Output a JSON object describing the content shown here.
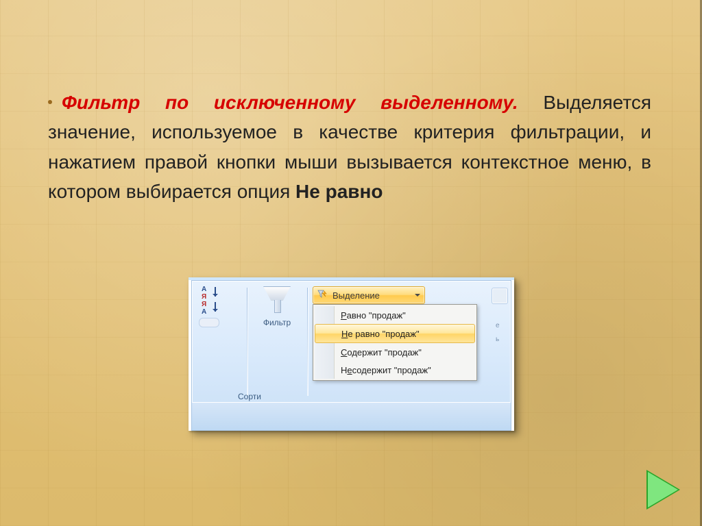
{
  "para": {
    "bullet_title": "Фильтр по исключенному выделенному.",
    "body_before": " Выделяется значение, используемое в качестве критерия фильтрации, и нажатием правой кнопки мыши вызывается контекстное меню, в котором выбирается опция ",
    "option_bold": "Не равно"
  },
  "ribbon": {
    "sort_group_label": "Сорти",
    "filter_button_label": "Фильтр",
    "selection_button_label": "Выделение",
    "right_frag_line1": "е",
    "right_frag_line2": "ь"
  },
  "dropdown": {
    "items": [
      {
        "pre": "",
        "u": "Р",
        "post": "авно \"продаж\"",
        "hl": false
      },
      {
        "pre": "",
        "u": "Н",
        "post": "е равно \"продаж\"",
        "hl": true
      },
      {
        "pre": "",
        "u": "С",
        "post": "одержит \"продаж\"",
        "hl": false
      },
      {
        "pre": "Н",
        "u": "е",
        "post": " содержит \"продаж\"",
        "hl": false
      }
    ]
  }
}
